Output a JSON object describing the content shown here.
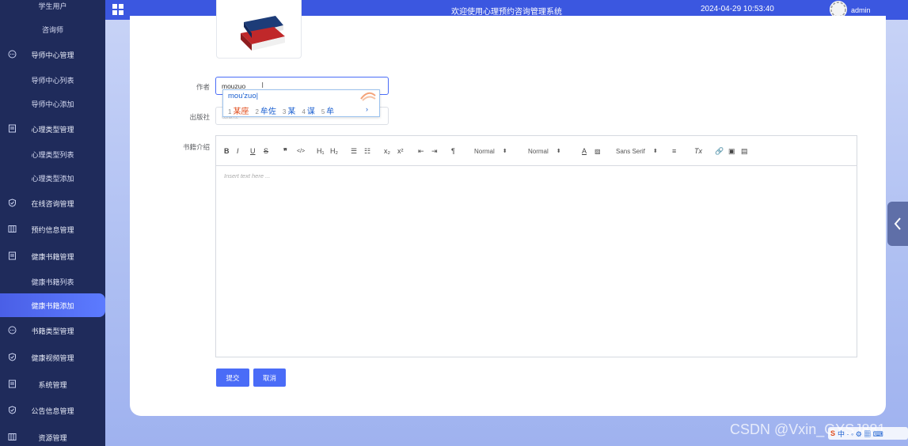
{
  "sidebar": {
    "items": [
      {
        "label": "学生用户",
        "kind": "sub",
        "top": 0
      },
      {
        "label": "咨询师",
        "kind": "sub"
      },
      {
        "label": "导师中心管理",
        "kind": "parent",
        "icon": "chat-icon"
      },
      {
        "label": "导师中心列表",
        "kind": "sub"
      },
      {
        "label": "导师中心添加",
        "kind": "sub"
      },
      {
        "label": "心理类型管理",
        "kind": "parent",
        "icon": "document-icon"
      },
      {
        "label": "心理类型列表",
        "kind": "sub"
      },
      {
        "label": "心理类型添加",
        "kind": "sub"
      },
      {
        "label": "在线咨询管理",
        "kind": "parent",
        "icon": "shield-icon"
      },
      {
        "label": "预约信息管理",
        "kind": "parent",
        "icon": "columns-icon"
      },
      {
        "label": "健康书籍管理",
        "kind": "parent",
        "icon": "document-icon"
      },
      {
        "label": "健康书籍列表",
        "kind": "sub"
      },
      {
        "label": "健康书籍添加",
        "kind": "sub",
        "active": true
      },
      {
        "label": "书籍类型管理",
        "kind": "parent",
        "icon": "chat-icon"
      },
      {
        "label": "健康视频管理",
        "kind": "parent",
        "icon": "shield-icon"
      },
      {
        "label": "系统管理",
        "kind": "parent",
        "icon": "document-icon"
      },
      {
        "label": "公告信息管理",
        "kind": "parent",
        "icon": "shield-icon"
      },
      {
        "label": "资源管理",
        "kind": "parent",
        "icon": "columns-icon"
      }
    ]
  },
  "topbar": {
    "title": "欢迎使用心理预约咨询管理系统",
    "datetime": "2024-04-29 10:53:40",
    "user": "admin"
  },
  "form": {
    "author_label": "作者",
    "author_value": "mouzuo",
    "publisher_label": "出版社",
    "publisher_placeholder": "出版社",
    "intro_label": "书籍介绍",
    "editor_placeholder": "Insert text here ...",
    "submit_label": "提交",
    "cancel_label": "取消"
  },
  "ime": {
    "pinyin": "mou'zuo|",
    "candidates": [
      {
        "n": "1",
        "text": "某座"
      },
      {
        "n": "2",
        "text": "牟佐"
      },
      {
        "n": "3",
        "text": "某"
      },
      {
        "n": "4",
        "text": "谋"
      },
      {
        "n": "5",
        "text": "牟"
      }
    ],
    "more": "›"
  },
  "toolbar": {
    "header_select": "Normal",
    "size_select": "Normal",
    "font_select": "Sans Serif"
  },
  "watermark": "CSDN @Vxin_GYSJ881",
  "tray": "中 · ◦ ⚙ ▦ ⌨"
}
